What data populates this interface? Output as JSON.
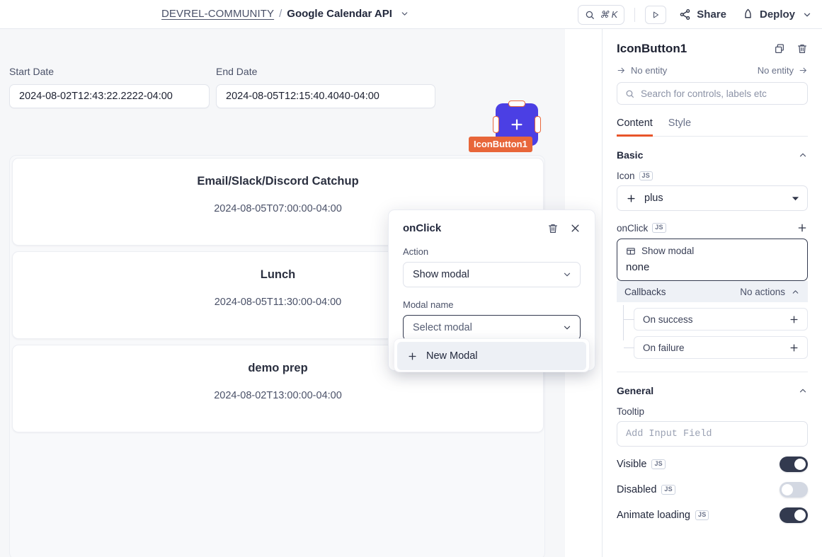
{
  "topbar": {
    "org": "DEVREL-COMMUNITY",
    "separator": "/",
    "app_name": "Google Calendar API",
    "search_shortcut": "⌘ K",
    "share_label": "Share",
    "deploy_label": "Deploy"
  },
  "canvas": {
    "start_date": {
      "label": "Start Date",
      "value": "2024-08-02T12:43:22.2222-04:00"
    },
    "end_date": {
      "label": "End Date",
      "value": "2024-08-05T12:15:40.4040-04:00"
    },
    "widget": {
      "name": "IconButton1",
      "icon": "plus-icon"
    },
    "events": [
      {
        "title": "Email/Slack/Discord Catchup",
        "time": "2024-08-05T07:00:00-04:00"
      },
      {
        "title": "Lunch",
        "time": "2024-08-05T11:30:00-04:00"
      },
      {
        "title": "demo prep",
        "time": "2024-08-02T13:00:00-04:00"
      }
    ]
  },
  "popover": {
    "title": "onClick",
    "action_label": "Action",
    "action_value": "Show modal",
    "modal_label": "Modal name",
    "modal_placeholder": "Select modal",
    "dropdown_options": [
      "New Modal"
    ]
  },
  "panel": {
    "title": "IconButton1",
    "entity_left": "No entity",
    "entity_right": "No entity",
    "search_placeholder": "Search for controls, labels etc",
    "tabs": [
      {
        "label": "Content",
        "active": true
      },
      {
        "label": "Style",
        "active": false
      }
    ],
    "basic": {
      "section": "Basic",
      "icon_label": "Icon",
      "icon_badge": "JS",
      "icon_value": "plus",
      "onclick_label": "onClick",
      "onclick_badge": "JS",
      "action_type": "Show modal",
      "action_value": "none",
      "callbacks_label": "Callbacks",
      "callbacks_status": "No actions",
      "on_success": "On success",
      "on_failure": "On failure"
    },
    "general": {
      "section": "General",
      "tooltip_label": "Tooltip",
      "tooltip_placeholder": "Add Input Field",
      "visible_label": "Visible",
      "visible_badge": "JS",
      "visible_on": true,
      "disabled_label": "Disabled",
      "disabled_badge": "JS",
      "disabled_on": false,
      "animate_label": "Animate loading",
      "animate_badge": "JS",
      "animate_on": true
    }
  },
  "colors": {
    "accent": "#e8552a",
    "widget": "#4b3fe4",
    "badge": "#e8663a",
    "canvas_bg": "#f6f7f9"
  }
}
